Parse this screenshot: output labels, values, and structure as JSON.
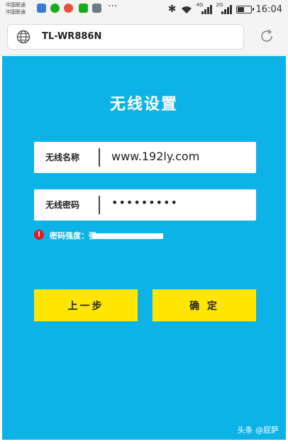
{
  "status_bar": {
    "carrier_line1": "中国联通",
    "carrier_line2": "中国联通",
    "more": "···",
    "bluetooth_icon": "bluetooth-icon",
    "net1": "4G",
    "net2": "2G",
    "time": "16:04",
    "notification_colors": [
      "#3a7bd5",
      "#1aad19",
      "#e94e3c",
      "#1aad19",
      "#6c7a89"
    ]
  },
  "address_bar": {
    "url": "TL-WR886N",
    "globe_icon": "globe-icon",
    "reload_icon": "reload-icon"
  },
  "page": {
    "title": "无线设置",
    "ssid_label": "无线名称",
    "ssid_value": "www.192ly.com",
    "password_label": "无线密码",
    "password_value": "•••••••••",
    "strength_text": "密码强度：强",
    "strength_level": 1.0,
    "prev_button": "上一步",
    "ok_button": "确 定",
    "watermark": "头条 @屁萨"
  },
  "colors": {
    "panel": "#0db3e6",
    "button": "#ffe600",
    "warning": "#e02020"
  }
}
